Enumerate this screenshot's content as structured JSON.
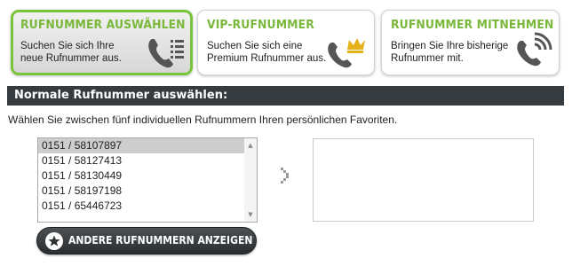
{
  "tabs": [
    {
      "title": "RUFNUMMER AUSWÄHLEN",
      "line1": "Suchen Sie sich Ihre",
      "line2": "neue Rufnummer aus.",
      "icon": "phone-list-icon"
    },
    {
      "title": "VIP-RUFNUMMER",
      "line1": "Suchen Sie sich eine",
      "line2": "Premium Rufnummer aus.",
      "icon": "phone-crown-icon"
    },
    {
      "title": "RUFNUMMER MITNEHMEN",
      "line1": "Bringen Sie Ihre bisherige",
      "line2": "Rufnummer mit.",
      "icon": "phone-signal-icon"
    }
  ],
  "section": {
    "title": "Normale Rufnummer auswählen:",
    "intro": "Wählen Sie zwischen fünf individuellen Rufnummern Ihren persönlichen Favoriten."
  },
  "numbers": [
    "0151 / 58107897",
    "0151 / 58127413",
    "0151 / 58130449",
    "0151 / 58197198",
    "0151 / 65446723"
  ],
  "selected_number": "0151 / 58107897",
  "more_button": {
    "label": "ANDERE RUFNUMMERN ANZEIGEN",
    "icon": "star-icon"
  },
  "colors": {
    "accent_green": "#7ab83c",
    "dark_bar": "#353b3f"
  }
}
